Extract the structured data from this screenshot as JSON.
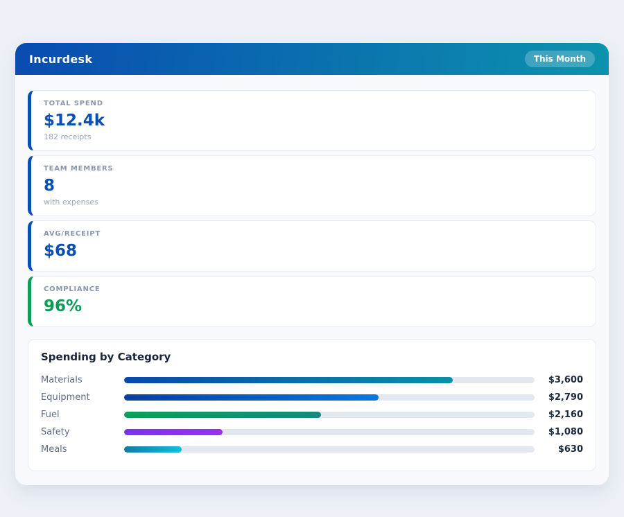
{
  "header": {
    "title": "Incurdesk",
    "badge": "This Month",
    "gradient": [
      "#0a4bb0",
      "#0c93ad"
    ]
  },
  "stats": [
    {
      "label": "TOTAL SPEND",
      "value": "$12.4k",
      "sub": "182 receipts",
      "accent": "#0b4fb3",
      "value_color": "#0b4fb3"
    },
    {
      "label": "TEAM MEMBERS",
      "value": "8",
      "sub": "with expenses",
      "accent": "#0b4fb3",
      "value_color": "#0b4fb3"
    },
    {
      "label": "AVG/RECEIPT",
      "value": "$68",
      "sub": "",
      "accent": "#0b4fb3",
      "value_color": "#0b4fb3"
    },
    {
      "label": "COMPLIANCE",
      "value": "96%",
      "sub": "",
      "accent": "#0f9d58",
      "value_color": "#0c9b57"
    }
  ],
  "chart_data": {
    "type": "bar",
    "orientation": "horizontal",
    "title": "Spending by Category",
    "categories": [
      "Materials",
      "Equipment",
      "Fuel",
      "Safety",
      "Meals"
    ],
    "values": [
      3600,
      2790,
      2160,
      1080,
      630
    ],
    "value_labels": [
      "$3,600",
      "$2,790",
      "$2,160",
      "$1,080",
      "$630"
    ],
    "xlim": [
      0,
      4500
    ],
    "grid": false,
    "legend": "none",
    "track_color": "#e3e8ef",
    "bar_gradients": [
      [
        "#0a47ad",
        "#0a90a6"
      ],
      [
        "#0a3f9e",
        "#0b78dd"
      ],
      [
        "#0e9e57",
        "#15897f"
      ],
      [
        "#7634e8",
        "#9c2ff0"
      ],
      [
        "#147c9e",
        "#0cbfdb"
      ]
    ]
  }
}
